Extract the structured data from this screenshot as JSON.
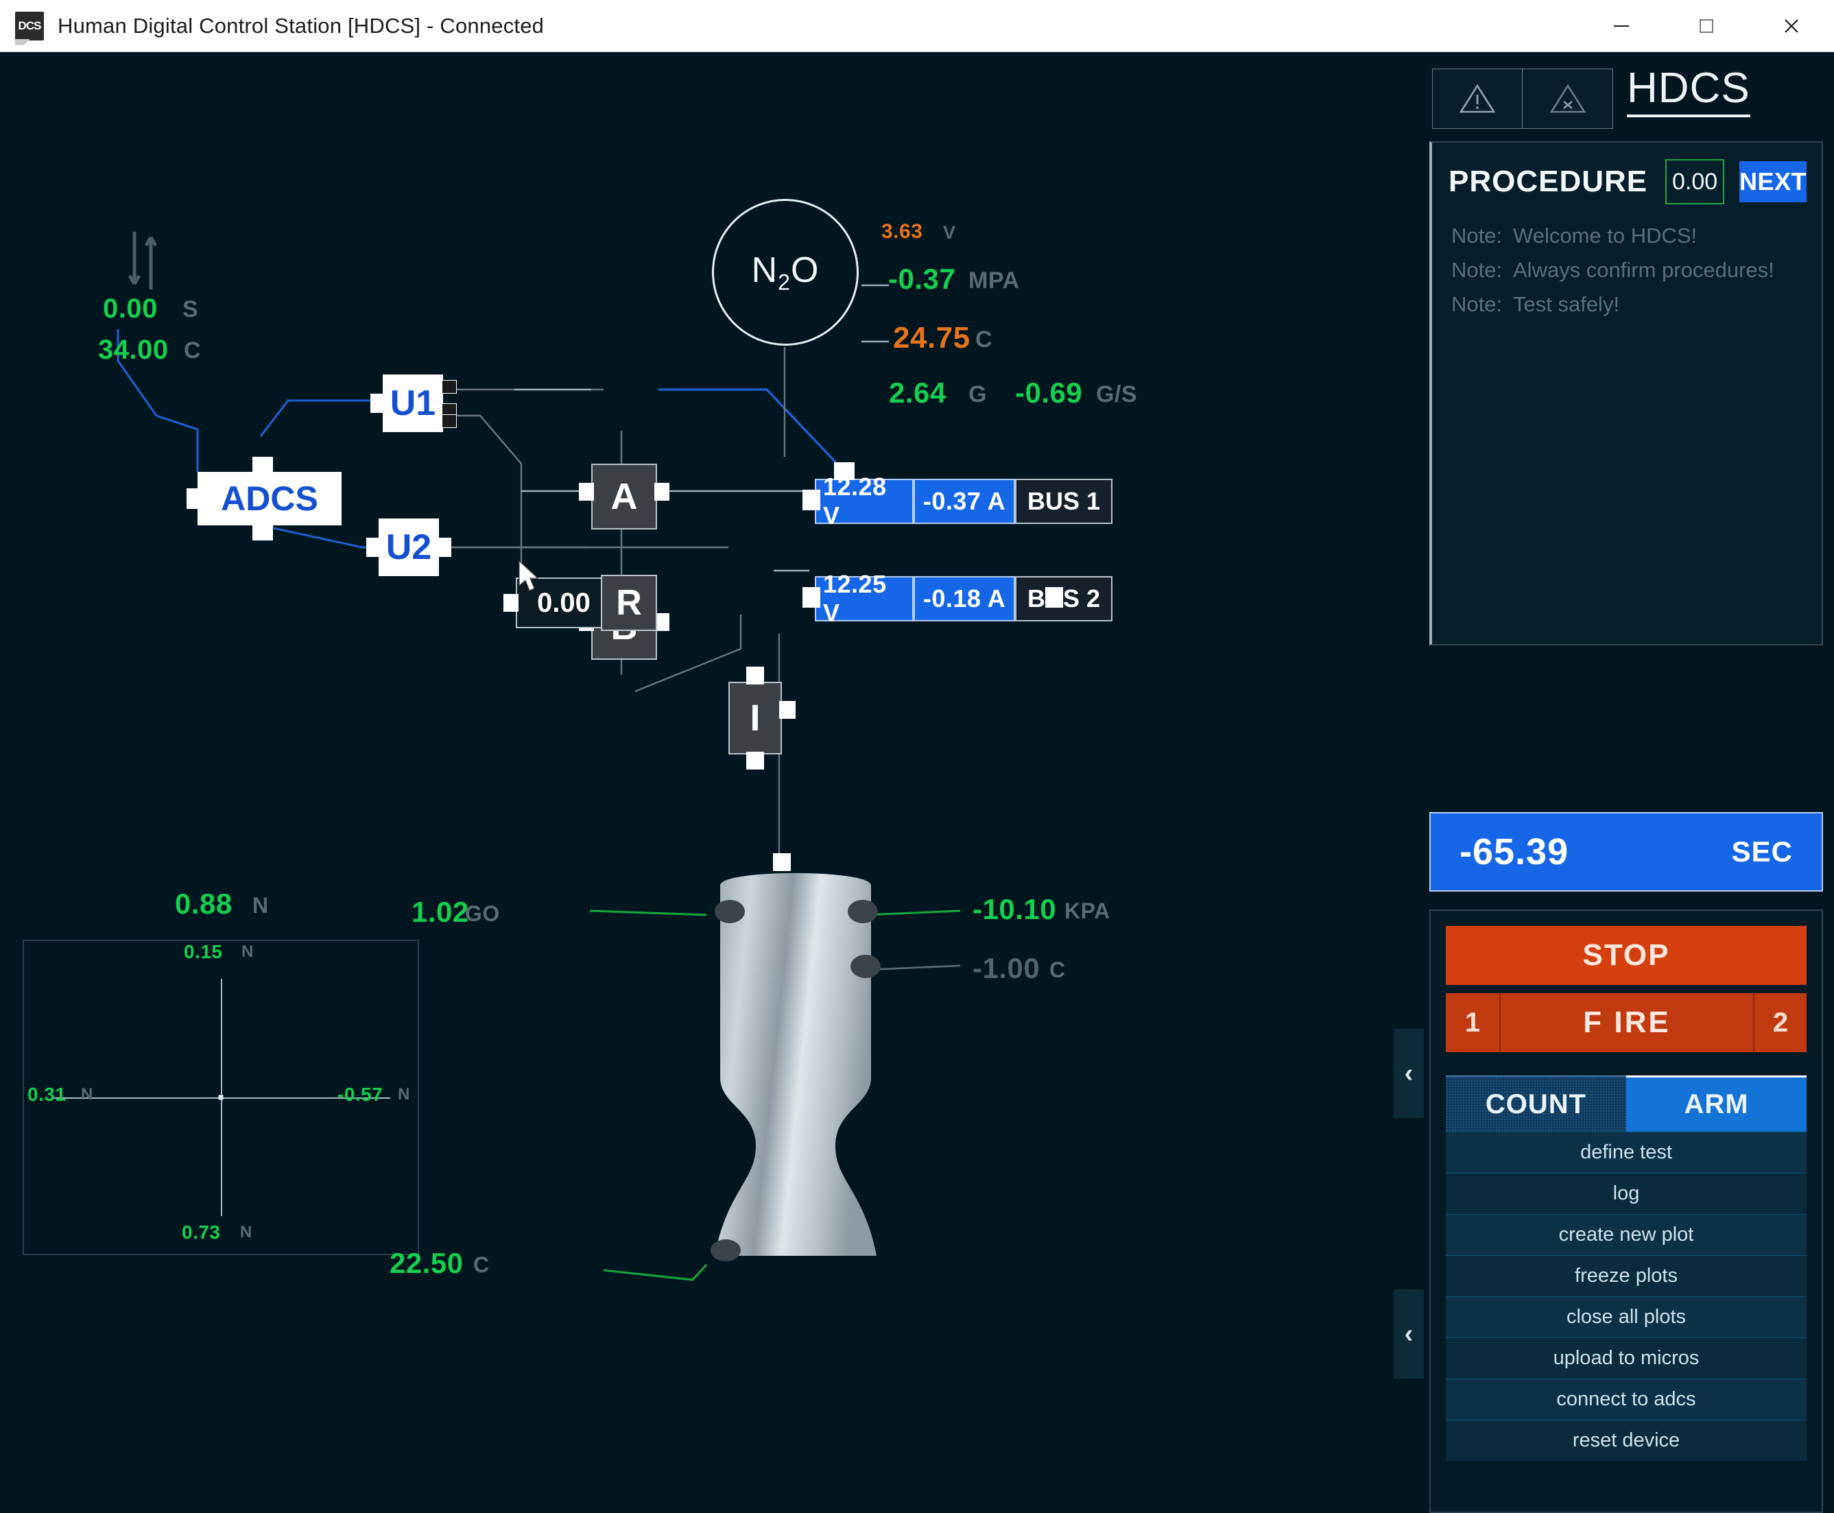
{
  "window": {
    "title": "Human Digital Control Station [HDCS] - Connected",
    "icon_label": "DCS",
    "minimize_icon": "minimize-icon",
    "maximize_icon": "maximize-icon",
    "close_icon": "close-icon"
  },
  "canvas": {
    "flow_sensor": {
      "icon": "flow-arrows-icon",
      "rate_value": "0.00",
      "rate_unit": "S",
      "temp_value": "34.00",
      "temp_unit": "C"
    },
    "tank": {
      "label": "N",
      "label_sub": "2",
      "label_tail": "O",
      "readings": [
        {
          "value": "3.63",
          "unit": "V",
          "color": "orange"
        },
        {
          "value": "-0.37",
          "unit": "MPA",
          "color": "green"
        },
        {
          "value": "24.75",
          "unit": "C",
          "color": "orange"
        },
        {
          "value": "2.64",
          "unit": "G",
          "color": "green"
        },
        {
          "value": "-0.69",
          "unit": "G/S",
          "color": "green"
        }
      ]
    },
    "nodes": {
      "adcs": "ADCS",
      "u1": "U1",
      "u2": "U2",
      "a": "A",
      "b": "B",
      "i": "I",
      "r": "R",
      "r_value": "0.00"
    },
    "buses": [
      {
        "name": "BUS 1",
        "voltage": "12.28 V",
        "current": "-0.37 A"
      },
      {
        "name": "BUS 2",
        "voltage": "12.25 V",
        "current": "-0.18 A"
      }
    ],
    "load_cell": {
      "total_value": "0.88",
      "total_unit": "N",
      "top_value": "0.15",
      "top_unit": "N",
      "left_value": "0.31",
      "left_unit": "N",
      "right_value": "-0.57",
      "right_unit": "N",
      "bottom_value": "0.73",
      "bottom_unit": "N"
    },
    "engine": {
      "go_value": "1.02",
      "go_unit": "GO",
      "pressure_value": "-10.10",
      "pressure_unit": "KPA",
      "temp_top_value": "-1.00",
      "temp_top_unit": "C",
      "temp_bottom_value": "22.50",
      "temp_bottom_unit": "C"
    }
  },
  "sidebar": {
    "warn_caution_icon": "warning-triangle-icon",
    "warn_abort_icon": "warning-triangle-x-icon",
    "app_title": "HDCS",
    "procedure": {
      "label": "PROCEDURE",
      "step_value": "0.00",
      "next_label": "NEXT",
      "notes": [
        {
          "key": "Note:",
          "text": "Welcome to HDCS!"
        },
        {
          "key": "Note:",
          "text": "Always confirm procedures!"
        },
        {
          "key": "Note:",
          "text": "Test safely!"
        }
      ]
    },
    "timer": {
      "value": "-65.39",
      "unit": "SEC"
    },
    "controls": {
      "stop_label": "STOP",
      "fire_left": "1",
      "fire_label": "F IRE",
      "fire_right": "2",
      "tab_count": "COUNT",
      "tab_arm": "ARM",
      "menu_items": [
        "define test",
        "log",
        "create new plot",
        "freeze plots",
        "close all plots",
        "upload to micros",
        "connect to adcs",
        "reset device"
      ]
    },
    "collapse_icon": "chevron-left-icon"
  }
}
